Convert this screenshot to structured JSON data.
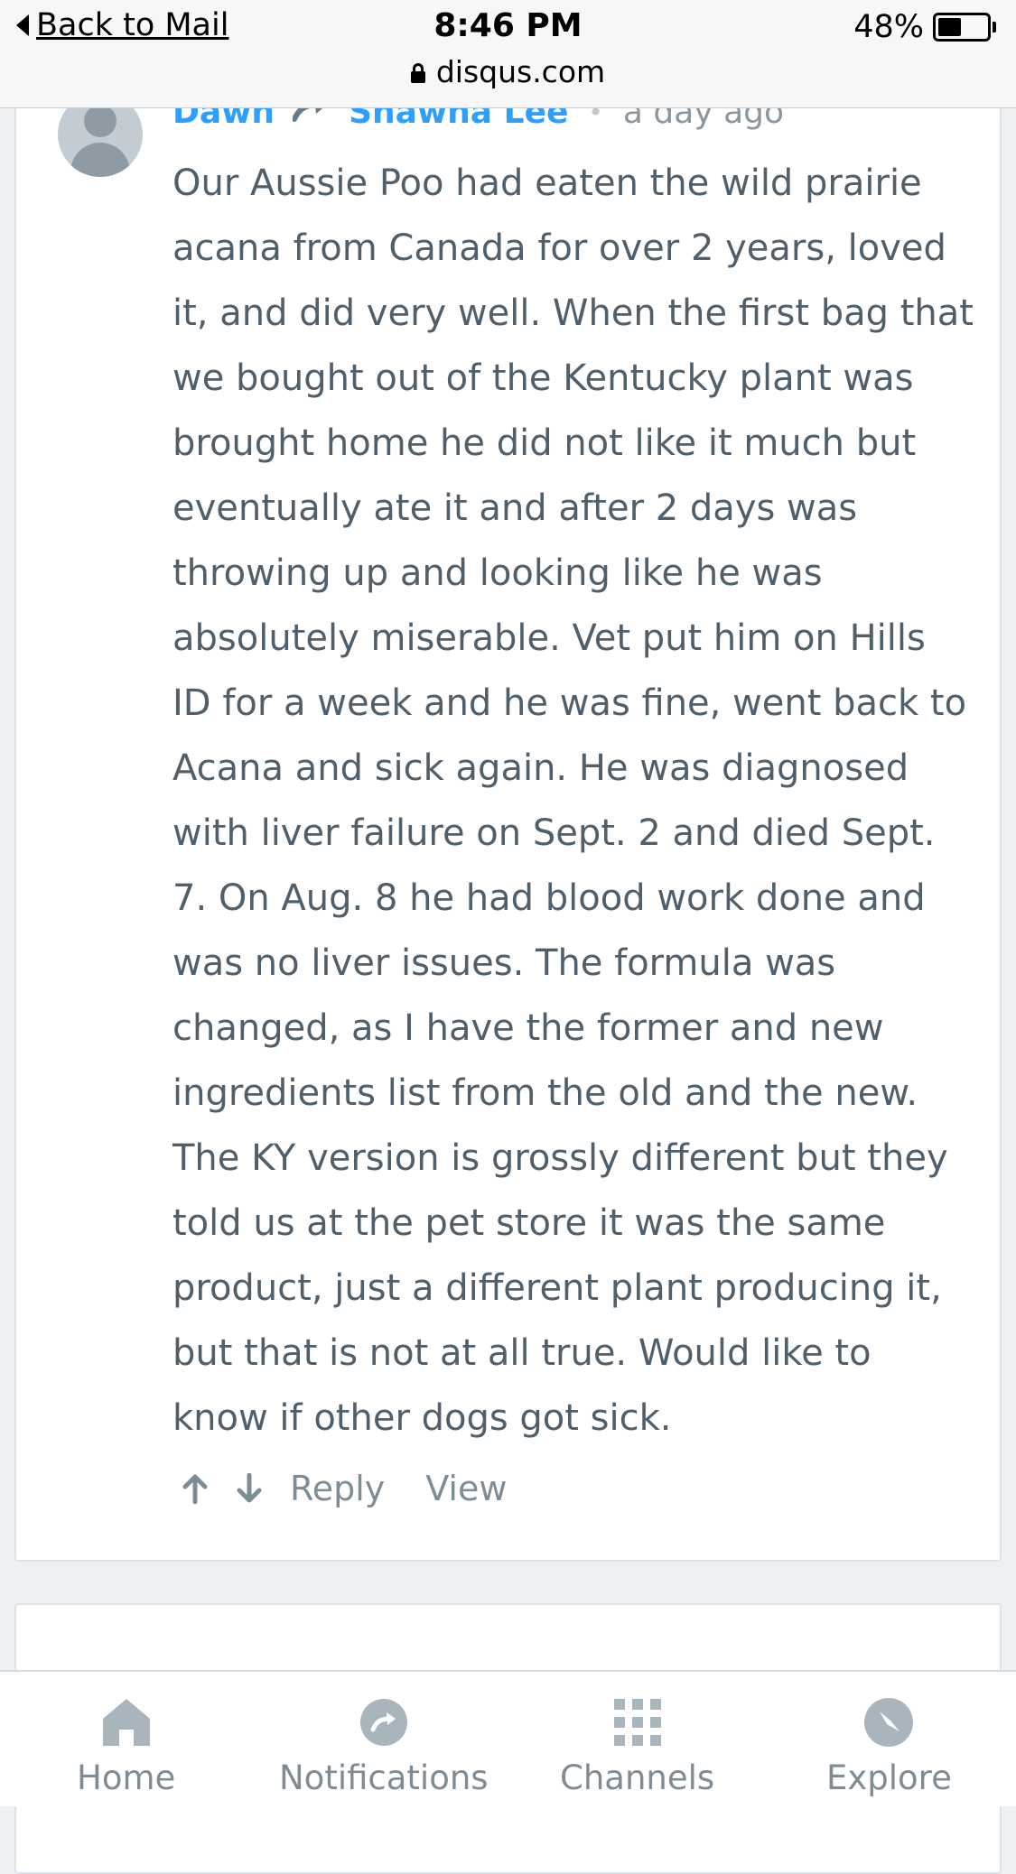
{
  "status_bar": {
    "back_label": "Back to Mail",
    "time": "8:46 PM",
    "battery_percent": "48%",
    "battery_level": 0.48,
    "url": "disqus.com"
  },
  "comment": {
    "author": "Dawn",
    "reply_to": "Shawna Lee",
    "separator": "•",
    "timestamp": "a day ago",
    "body_lines": [
      "Our Aussie Poo had eaten the wild prairie",
      "acana from Canada for over 2 years, loved",
      "it, and did very well. When the first bag that",
      "we bought out of the Kentucky plant was",
      "brought home he did not like it much but",
      "eventually ate it and after 2 days was",
      "throwing up and looking like he was",
      "absolutely miserable. Vet put him on Hills",
      "ID for a week and he was fine, went back to",
      "Acana and sick again. He was diagnosed",
      "with liver failure on Sept. 2 and died Sept.",
      "7. On Aug. 8 he had blood work done and",
      "was no liver issues. The formula was",
      "changed, as I have the former and new",
      "ingredients list from the old and the new.",
      "The KY version is grossly different but they",
      "told us at the pet store it was the same",
      "product, just a different plant producing it,",
      "but that is not at all true. Would like to",
      "know if other dogs got sick."
    ],
    "actions": {
      "reply": "Reply",
      "view": "View"
    }
  },
  "tabbar": {
    "items": [
      {
        "label": "Home",
        "icon": "home-icon"
      },
      {
        "label": "Notifications",
        "icon": "notification-icon"
      },
      {
        "label": "Channels",
        "icon": "channels-grid-icon"
      },
      {
        "label": "Explore",
        "icon": "compass-icon"
      }
    ]
  },
  "colors": {
    "accent": "#2e9fff",
    "body_text": "#4f5f6b",
    "muted": "#7f8c96"
  }
}
